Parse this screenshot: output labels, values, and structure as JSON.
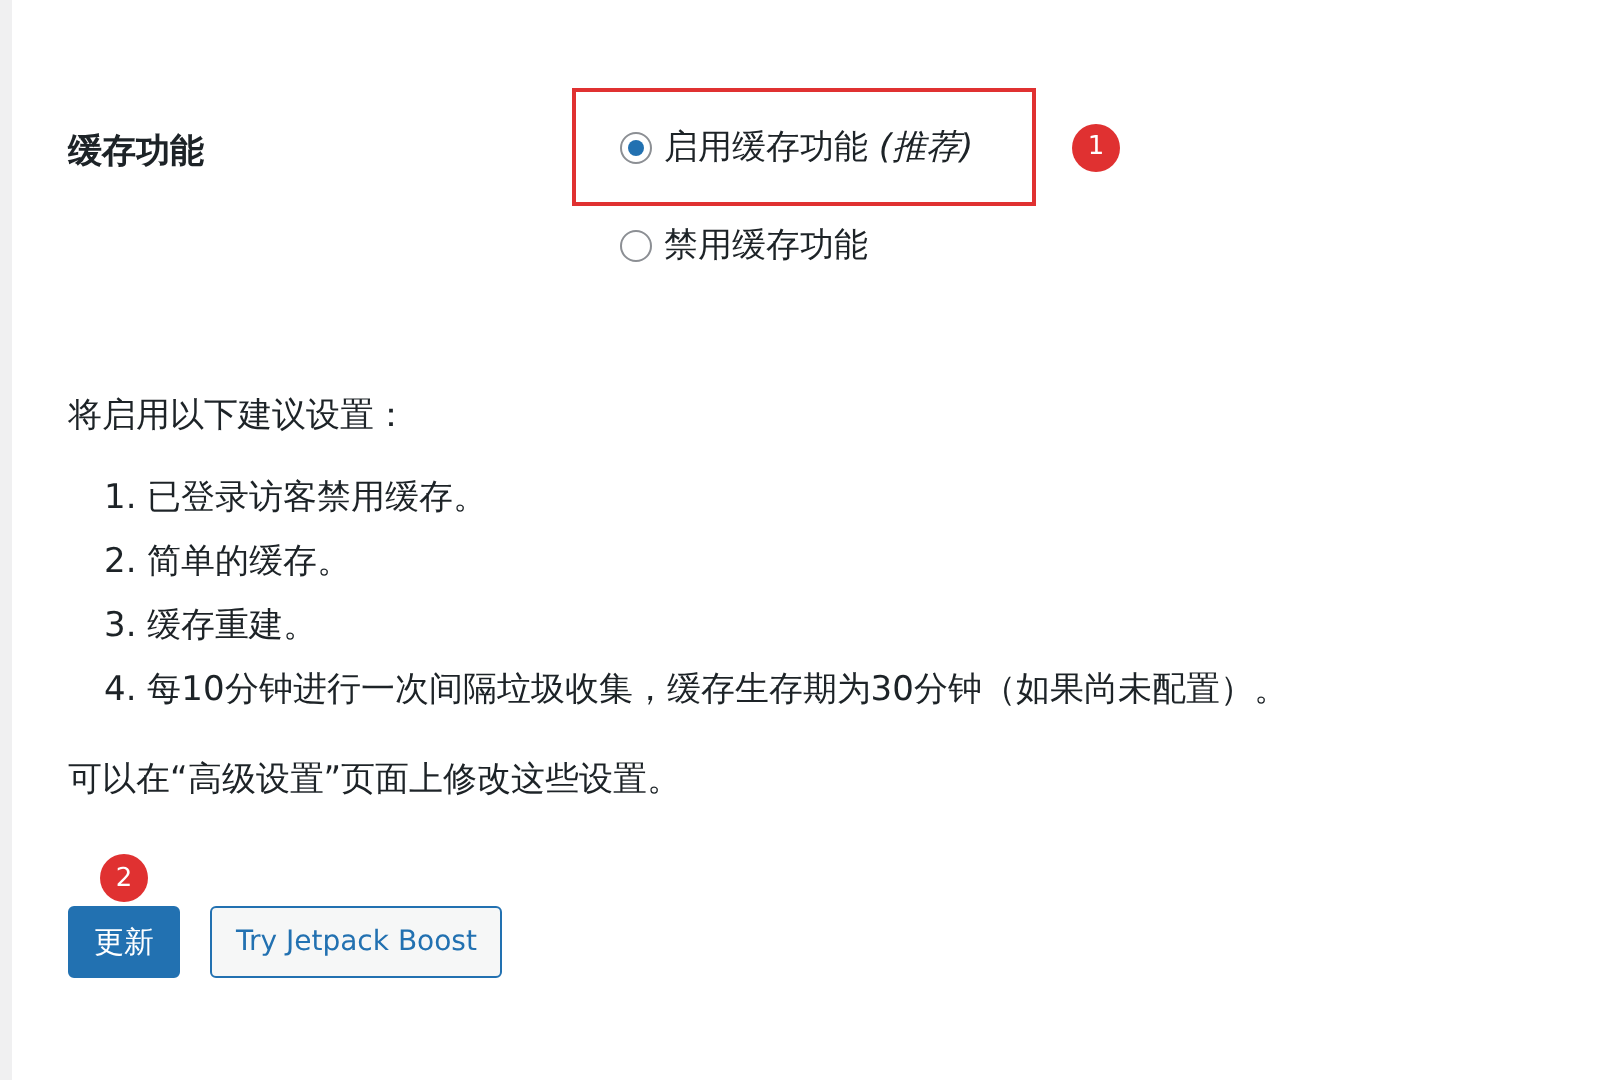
{
  "setting": {
    "label": "缓存功能",
    "options": [
      {
        "label": "启用缓存功能 *(推荐)*",
        "selected": true,
        "highlighted": true,
        "badge": "1"
      },
      {
        "label": "禁用缓存功能",
        "selected": false,
        "highlighted": false
      }
    ]
  },
  "intro": "将启用以下建议设置：",
  "list": [
    "1. 已登录访客禁用缓存。",
    "2. 简单的缓存。",
    "3. 缓存重建。",
    "4. 每10分钟进行一次间隔垃圾收集，缓存生存期为30分钟（如果尚未配置）。"
  ],
  "note": "可以在“高级设置”页面上修改这些设置。",
  "buttons": [
    {
      "label": "更新",
      "kind": "primary",
      "badge": "2"
    },
    {
      "label": "Try Jetpack Boost",
      "kind": "secondary"
    }
  ]
}
